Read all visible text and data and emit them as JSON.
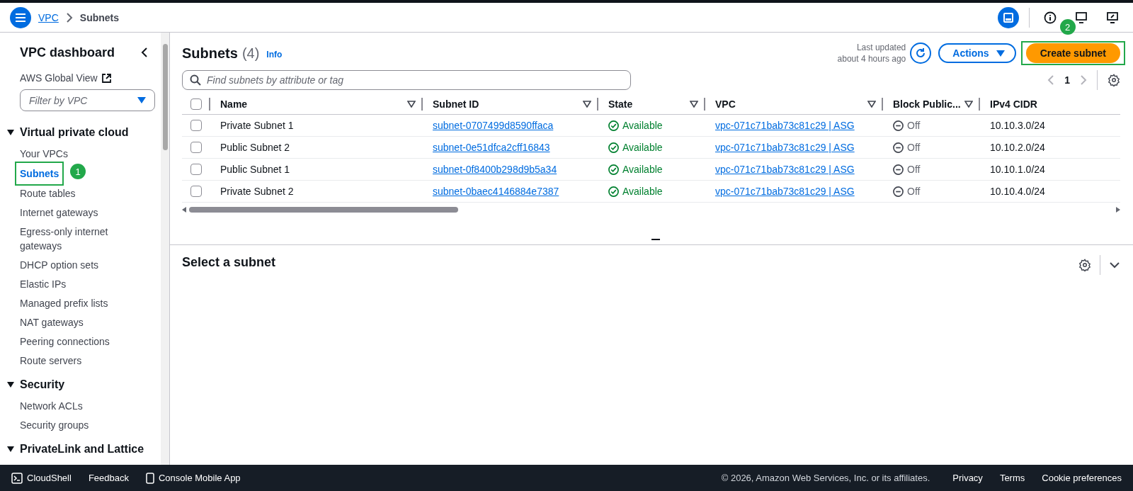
{
  "header": {
    "breadcrumbs": [
      {
        "label": "VPC",
        "link": true
      },
      {
        "label": "Subnets",
        "link": false
      }
    ]
  },
  "sidebar": {
    "title": "VPC dashboard",
    "global_view": "AWS Global View",
    "filter": {
      "placeholder": "Filter by VPC"
    },
    "sections": [
      {
        "title": "Virtual private cloud",
        "expanded": true,
        "items": [
          {
            "label": "Your VPCs",
            "selected": false
          },
          {
            "label": "Subnets",
            "selected": true,
            "callout": "1"
          },
          {
            "label": "Route tables",
            "selected": false
          },
          {
            "label": "Internet gateways",
            "selected": false
          },
          {
            "label": "Egress-only internet gateways",
            "selected": false
          },
          {
            "label": "DHCP option sets",
            "selected": false
          },
          {
            "label": "Elastic IPs",
            "selected": false
          },
          {
            "label": "Managed prefix lists",
            "selected": false
          },
          {
            "label": "NAT gateways",
            "selected": false
          },
          {
            "label": "Peering connections",
            "selected": false
          },
          {
            "label": "Route servers",
            "selected": false
          }
        ]
      },
      {
        "title": "Security",
        "expanded": true,
        "items": [
          {
            "label": "Network ACLs",
            "selected": false
          },
          {
            "label": "Security groups",
            "selected": false
          }
        ]
      },
      {
        "title": "PrivateLink and Lattice",
        "expanded": true
      }
    ]
  },
  "main": {
    "title": "Subnets",
    "count": "(4)",
    "info": "Info",
    "last_updated": "Last updated",
    "updated_ago": "about 4 hours ago",
    "actions": "Actions",
    "create": {
      "label": "Create subnet",
      "callout": "2"
    },
    "search": {
      "placeholder": "Find subnets by attribute or tag"
    },
    "page": "1",
    "all_checked": false,
    "columns": [
      "Name",
      "Subnet ID",
      "State",
      "VPC",
      "Block Public...",
      "IPv4 CIDR"
    ],
    "rows": [
      {
        "checked": false,
        "name": "Private Subnet 1",
        "subnet_id": "subnet-0707499d8590ffaca",
        "state": "Available",
        "vpc": "vpc-071c71bab73c81c29 | ASG",
        "block": "Off",
        "cidr": "10.10.3.0/24"
      },
      {
        "checked": false,
        "name": "Public Subnet 2",
        "subnet_id": "subnet-0e51dfca2cff16843",
        "state": "Available",
        "vpc": "vpc-071c71bab73c81c29 | ASG",
        "block": "Off",
        "cidr": "10.10.2.0/24"
      },
      {
        "checked": false,
        "name": "Public Subnet 1",
        "subnet_id": "subnet-0f8400b298d9b5a34",
        "state": "Available",
        "vpc": "vpc-071c71bab73c81c29 | ASG",
        "block": "Off",
        "cidr": "10.10.1.0/24"
      },
      {
        "checked": false,
        "name": "Private Subnet 2",
        "subnet_id": "subnet-0baec4146884e7387",
        "state": "Available",
        "vpc": "vpc-071c71bab73c81c29 | ASG",
        "block": "Off",
        "cidr": "10.10.4.0/24"
      }
    ]
  },
  "detail": {
    "title": "Select a subnet"
  },
  "footer": {
    "left": [
      "CloudShell",
      "Feedback",
      "Console Mobile App"
    ],
    "copyright": "© 2026, Amazon Web Services, Inc. or its affiliates.",
    "links": [
      "Privacy",
      "Terms",
      "Cookie preferences"
    ]
  }
}
